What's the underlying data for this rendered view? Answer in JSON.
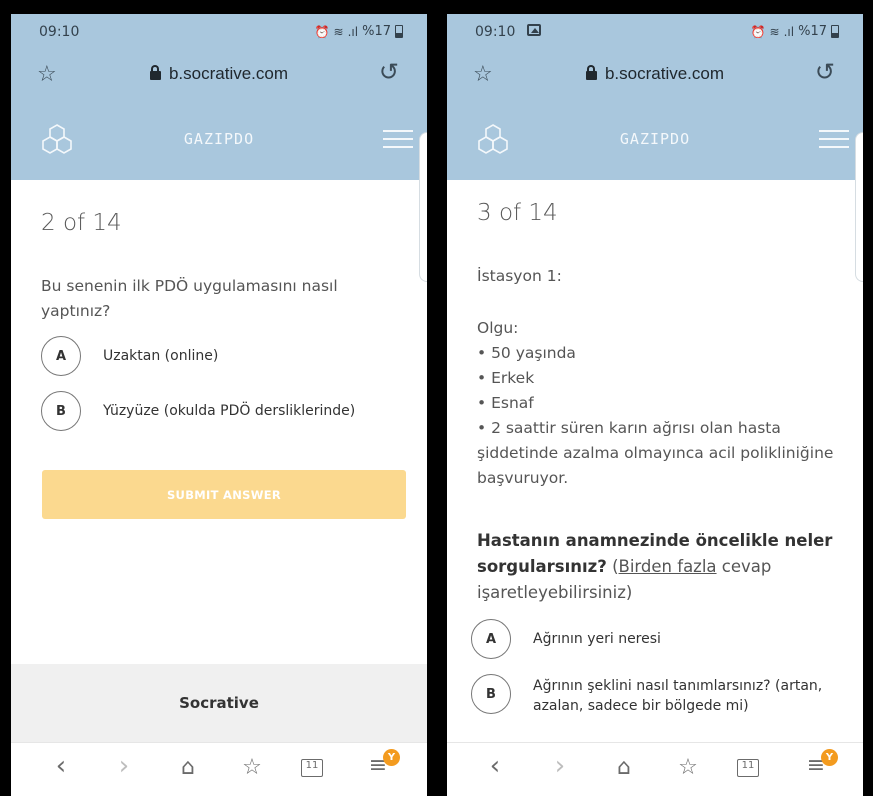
{
  "left": {
    "status": {
      "time": "09:10",
      "battery": "%17"
    },
    "browser": {
      "url": "b.socrative.com"
    },
    "app": {
      "room_name": "GAZIPDO"
    },
    "progress": "2 of 14",
    "question": "Bu senenin ilk PDÖ uygulamasını nasıl yaptınız?",
    "answers": [
      {
        "letter": "A",
        "text": "Uzaktan (online)"
      },
      {
        "letter": "B",
        "text": "Yüzyüze (okulda PDÖ dersliklerinde)"
      }
    ],
    "submit_label": "SUBMIT ANSWER",
    "footer_text": "Socrative",
    "tabs_count": "11",
    "menu_badge": "Y"
  },
  "right": {
    "status": {
      "time": "09:10",
      "battery": "%17"
    },
    "browser": {
      "url": "b.socrative.com"
    },
    "app": {
      "room_name": "GAZIPDO"
    },
    "progress": "3 of 14",
    "station": "İstasyon 1:",
    "case_heading": "Olgu:",
    "case_items": [
      "• 50 yaşında",
      "• Erkek",
      "• Esnaf",
      "• 2 saattir süren karın ağrısı olan hasta şiddetinde azalma olmayınca acil polikliniğine başvuruyor."
    ],
    "question_bold": "Hastanın anamnezinde öncelikle neler sorgularsınız?",
    "question_link": "Birden fazla",
    "question_rest": " cevap işaretleyebilirsiniz)",
    "answers": [
      {
        "letter": "A",
        "text": "Ağrının yeri neresi"
      },
      {
        "letter": "B",
        "text": "Ağrının şeklini nasıl tanımlarsınız? (artan, azalan, sadece bir bölgede mi)"
      }
    ],
    "tabs_count": "11",
    "menu_badge": "Y"
  },
  "colors": {
    "header_bg": "#a9c7dd",
    "submit_bg": "#fbd98f",
    "badge": "#f39b1f",
    "footer_bg": "#f0f0f0"
  },
  "icons": [
    "star-icon",
    "lock-icon",
    "reload-icon",
    "socrative-logo-icon",
    "hamburger-menu-icon",
    "back-icon",
    "forward-icon",
    "home-icon",
    "bookmarks-icon",
    "tabs-icon",
    "browser-menu-icon",
    "alarm-icon",
    "wifi-icon",
    "signal-icon",
    "battery-icon",
    "image-notification-icon"
  ]
}
